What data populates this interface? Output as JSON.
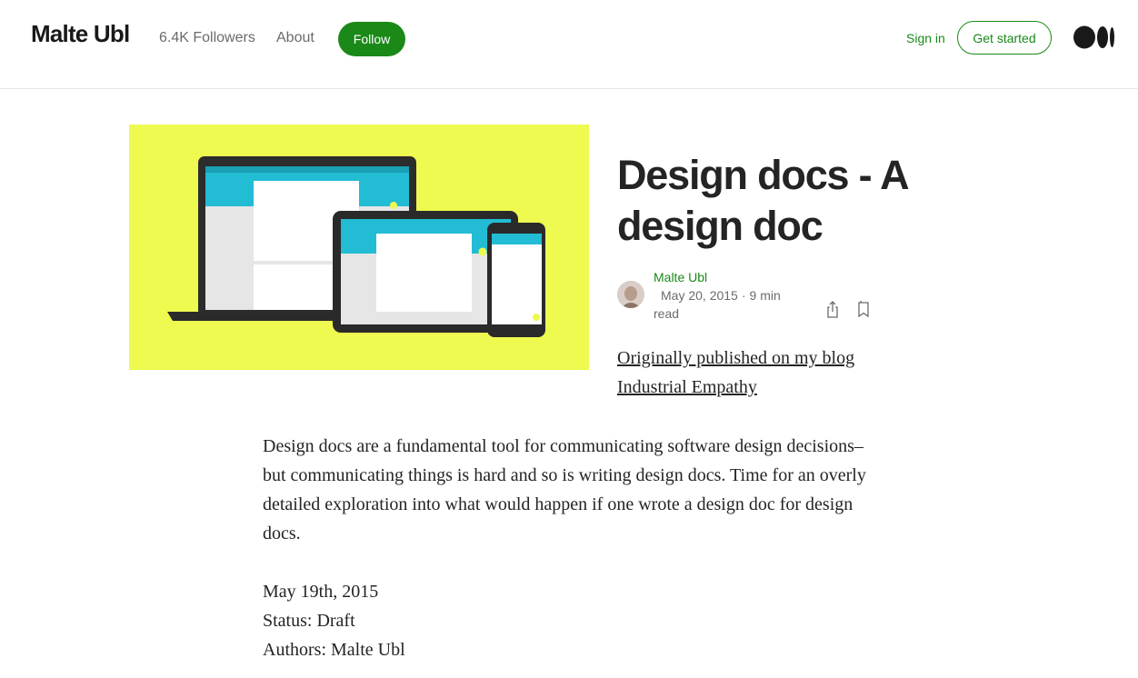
{
  "header": {
    "publication_name": "Malte Ubl",
    "followers": "6.4K Followers",
    "about": "About",
    "follow": "Follow",
    "sign_in": "Sign in",
    "get_started": "Get started",
    "logo_icon": "medium-logo-icon"
  },
  "article": {
    "title": "Design docs - A design doc",
    "author": "Malte Ubl",
    "date": "May 20, 2015",
    "read_time": "9 min read",
    "original_link": "Originally published on my blog Industrial Empathy",
    "intro": "Design docs are a fundamental tool for communicating software design decisions–but communicating things is hard and so is writing design docs. Time for an overly detailed exploration into what would happen if one wrote a design doc for design docs.",
    "doc_date": "May 19th, 2015",
    "status": "Status: Draft",
    "authors": "Authors: Malte Ubl"
  },
  "colors": {
    "accent_green": "#1a8917",
    "hero_background": "#eefa4f",
    "text": "#242424",
    "muted": "#6b6b6b"
  }
}
